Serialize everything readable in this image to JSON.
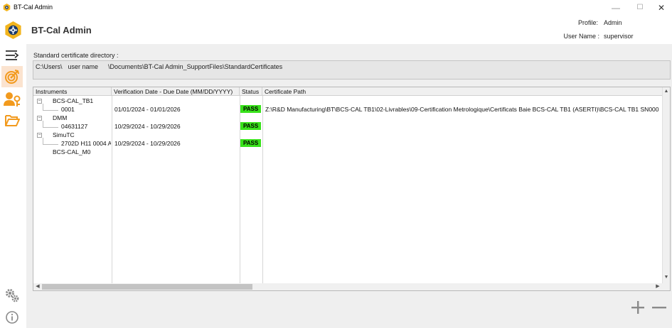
{
  "window": {
    "title": "BT-Cal Admin",
    "minimize_glyph": "—",
    "maximize_glyph": "☐",
    "close_glyph": "✕"
  },
  "header": {
    "app_title": "BT-Cal Admin",
    "profile_label": "Profile:",
    "profile_value": "Admin",
    "username_label": "User Name :",
    "username_value": "supervisor"
  },
  "sidebar": {
    "items": [
      {
        "icon": "collapse-menu-icon"
      },
      {
        "icon": "target-icon",
        "active": true
      },
      {
        "icon": "user-key-icon"
      },
      {
        "icon": "folder-open-icon"
      }
    ],
    "bottom_items": [
      {
        "icon": "settings-gears-icon"
      },
      {
        "icon": "info-icon"
      }
    ]
  },
  "directory": {
    "label": "Standard certificate directory :",
    "path_prefix": "C:\\Users\\",
    "path_user": "user name",
    "path_suffix": "\\Documents\\BT-Cal Admin_SupportFiles\\StandardCertificates"
  },
  "grid": {
    "columns": [
      "Instruments",
      "Verification Date - Due Date (MM/DD/YYYY)",
      "Status",
      "Certificate Path"
    ],
    "rows": [
      {
        "level": 0,
        "expander": "−",
        "name": "BCS-CAL_TB1",
        "dates": "",
        "status": "",
        "path": ""
      },
      {
        "level": 1,
        "expander": "",
        "name": "0001",
        "dates": "01/01/2024 - 01/01/2026",
        "status": "PASS",
        "path": "Z:\\R&D Manufacturing\\BT\\BCS-CAL TB1\\02-Livrables\\09-Certification Metrologique\\Certificats Baie BCS-CAL TB1 (ASERTI)\\BCS-CAL TB1 SN000"
      },
      {
        "level": 0,
        "expander": "−",
        "name": "DMM",
        "dates": "",
        "status": "",
        "path": ""
      },
      {
        "level": 1,
        "expander": "",
        "name": "04631127",
        "dates": "10/29/2024 - 10/29/2026",
        "status": "PASS",
        "path": ""
      },
      {
        "level": 0,
        "expander": "−",
        "name": "SimuTC",
        "dates": "",
        "status": "",
        "path": ""
      },
      {
        "level": 1,
        "expander": "",
        "name": "2702D H11 0004 A",
        "dates": "10/29/2024 - 10/29/2026",
        "status": "PASS",
        "path": ""
      },
      {
        "level": 0,
        "expander": "",
        "name": "BCS-CAL_M0",
        "dates": "",
        "status": "",
        "path": ""
      }
    ],
    "scroll_up_glyph": "▲",
    "scroll_down_glyph": "▼",
    "scroll_left_glyph": "◀",
    "scroll_right_glyph": "▶"
  },
  "actions": {
    "add_icon": "plus-icon",
    "remove_icon": "minus-icon"
  },
  "colors": {
    "accent": "#f29a1d",
    "pass": "#39e21b",
    "panel_bg": "#efefef",
    "active_sidebar": "#fbe3cf"
  }
}
